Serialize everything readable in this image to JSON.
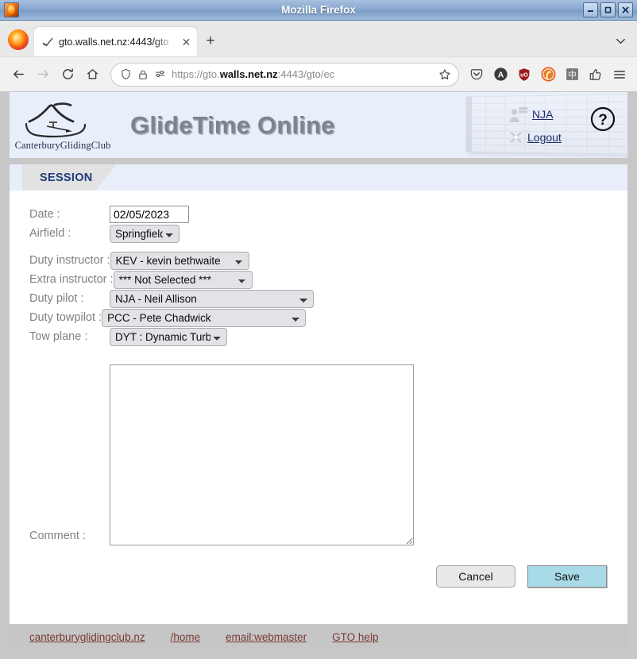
{
  "window": {
    "title": "Mozilla Firefox",
    "app_icon": "firefox-icon",
    "minimize_label": "–",
    "maximize_label": "□",
    "close_label": "✕"
  },
  "browser": {
    "tab": {
      "title": "gto.walls.net.nz:4443/gto",
      "favicon": "glider-favicon",
      "close_label": "✕"
    },
    "new_tab_label": "+",
    "tab_list_icon": "chevron-down-icon",
    "nav": {
      "back_label": "←",
      "forward_label": "→",
      "reload_label": "⟳",
      "home_label": "⌂"
    },
    "url": {
      "scheme": "https://gto.",
      "host": "walls.net.nz",
      "path": ":4443/gto/ec",
      "full": "https://gto.walls.net.nz:4443/gto/e"
    },
    "extensions": [
      {
        "name": "pocket-icon",
        "label": ""
      },
      {
        "name": "account-icon",
        "label": "A"
      },
      {
        "name": "ublock-origin-icon",
        "label": "uO"
      },
      {
        "name": "duckduckgo-privacy-icon",
        "label": ""
      },
      {
        "name": "chinese-input-icon",
        "label": "中"
      },
      {
        "name": "thumbs-up-icon",
        "label": ""
      },
      {
        "name": "hamburger-menu-icon",
        "label": "☰"
      }
    ]
  },
  "site": {
    "logo_text": "CanterburyGlidingClub",
    "title": "GlideTime Online",
    "user_link": "NJA",
    "logout_link": "Logout",
    "help_label": "?",
    "tab_label": "SESSION"
  },
  "form": {
    "date": {
      "label": "Date :",
      "value": "02/05/2023"
    },
    "airfield": {
      "label": "Airfield :",
      "value": "Springfield"
    },
    "duty_instructor": {
      "label": "Duty instructor :",
      "value": "KEV - kevin bethwaite"
    },
    "extra_instructor": {
      "label": "Extra instructor :",
      "value": "*** Not Selected ***"
    },
    "duty_pilot": {
      "label": "Duty pilot :",
      "value": "NJA - Neil Allison"
    },
    "duty_towpilot": {
      "label": "Duty towpilot :",
      "value": "PCC - Pete Chadwick"
    },
    "tow_plane": {
      "label": "Tow plane :",
      "value": "DYT : Dynamic Turbo"
    },
    "comment": {
      "label": "Comment :",
      "value": ""
    },
    "cancel_label": "Cancel",
    "save_label": "Save"
  },
  "footer": {
    "links": [
      "canterburyglidingclub.nz",
      "/home",
      "email:webmaster",
      "GTO help"
    ]
  },
  "colors": {
    "header_bg": "#e8eefa",
    "tab_bg": "#e2e2e2",
    "save_btn": "#a8dae7",
    "footer_link": "#7a3a34",
    "title_text": "#7e8390",
    "session_tab_text": "#1e3a7a"
  }
}
